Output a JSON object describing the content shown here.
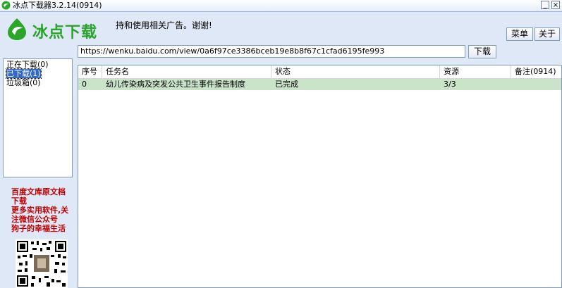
{
  "window": {
    "title": "冰点下载器3.2.14(0914)"
  },
  "brand": {
    "name": "冰点下载"
  },
  "marquee": "持和使用相关广告。谢谢!",
  "toolbar": {
    "menu_label": "菜单",
    "about_label": "关于",
    "download_label": "下载"
  },
  "url": {
    "value": "https://wenku.baidu.com/view/0a6f97ce3386bceb19e8b8f67c1cfad6195fe993"
  },
  "sidebar": {
    "items": [
      {
        "label": "正在下载(0)"
      },
      {
        "label": "已下载(1)",
        "selected": true
      },
      {
        "label": "垃圾箱(0)"
      }
    ]
  },
  "promo": {
    "line1": "百度文库原文档下载",
    "line2": "更多实用软件,关注微信公众号",
    "line3": "狗子的幸福生活"
  },
  "table": {
    "columns": [
      "序号",
      "任务名",
      "状态",
      "资源",
      "备注(0914)"
    ],
    "rows": [
      {
        "index": "0",
        "name": "幼儿传染病及突发公共卫生事件报告制度",
        "status": "已完成",
        "source": "3/3",
        "note": ""
      }
    ]
  },
  "colors": {
    "brand_green": "#29a329",
    "promo_red": "#c00000",
    "row_highlight": "#c9e4c9",
    "selection_blue": "#3169c6"
  }
}
